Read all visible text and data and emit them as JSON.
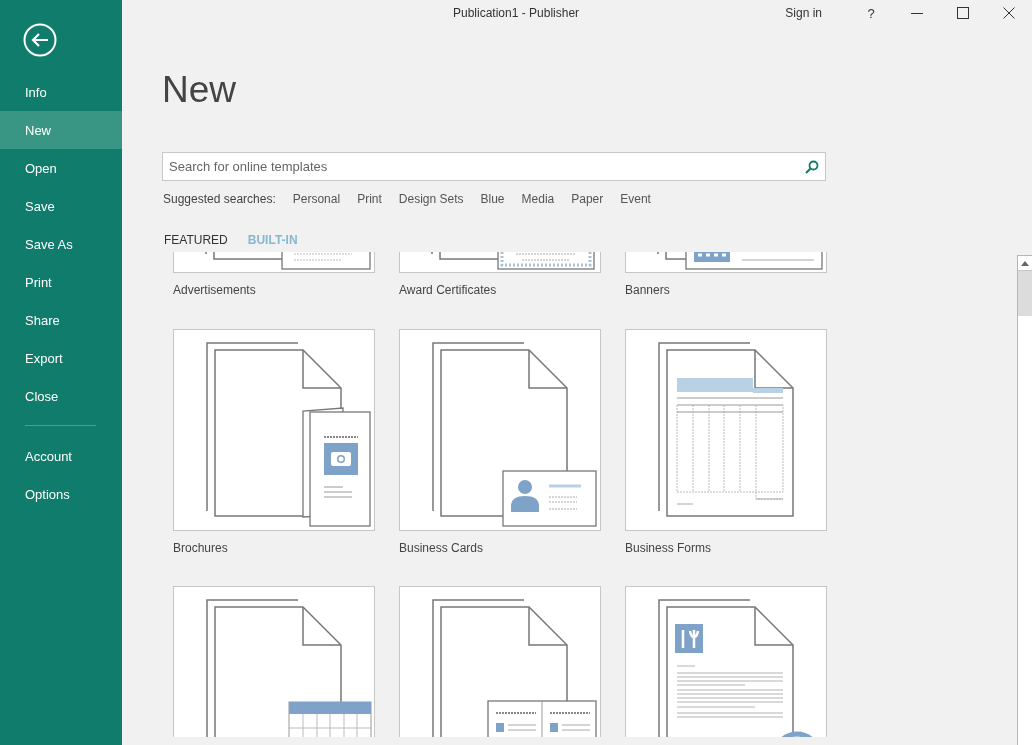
{
  "window": {
    "title": "Publication1 - Publisher",
    "sign_in": "Sign in",
    "help": "?"
  },
  "sidebar": {
    "items": [
      {
        "label": "Info",
        "selected": false
      },
      {
        "label": "New",
        "selected": true
      },
      {
        "label": "Open",
        "selected": false
      },
      {
        "label": "Save",
        "selected": false
      },
      {
        "label": "Save As",
        "selected": false
      },
      {
        "label": "Print",
        "selected": false
      },
      {
        "label": "Share",
        "selected": false
      },
      {
        "label": "Export",
        "selected": false
      },
      {
        "label": "Close",
        "selected": false
      }
    ],
    "footer_items": [
      {
        "label": "Account",
        "selected": false
      },
      {
        "label": "Options",
        "selected": false
      }
    ]
  },
  "heading": "New",
  "search": {
    "placeholder": "Search for online templates"
  },
  "suggested": {
    "label": "Suggested searches:",
    "links": [
      "Personal",
      "Print",
      "Design Sets",
      "Blue",
      "Media",
      "Paper",
      "Event"
    ]
  },
  "tabs": [
    {
      "label": "FEATURED",
      "selected": false
    },
    {
      "label": "BUILT-IN",
      "selected": true
    }
  ],
  "templates": [
    {
      "name": "Advertisements",
      "kind": "advertisement"
    },
    {
      "name": "Award Certificates",
      "kind": "certificate"
    },
    {
      "name": "Banners",
      "kind": "banner"
    },
    {
      "name": "Brochures",
      "kind": "brochure"
    },
    {
      "name": "Business Cards",
      "kind": "card"
    },
    {
      "name": "Business Forms",
      "kind": "form"
    },
    {
      "kind": "calendar"
    },
    {
      "kind": "newsletter"
    },
    {
      "kind": "flyer"
    }
  ]
}
